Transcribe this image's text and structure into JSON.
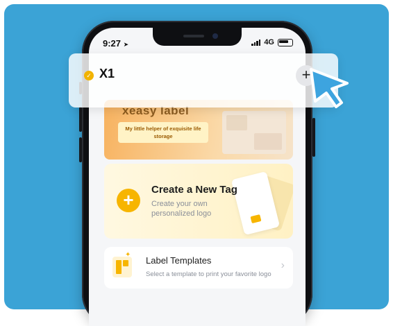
{
  "status_bar": {
    "time": "9:27",
    "network": "4G"
  },
  "header": {
    "device_name": "X1"
  },
  "banner": {
    "title": "xeasy label",
    "subtitle": "My little helper of exquisite life storage"
  },
  "create_card": {
    "title": "Create a New Tag",
    "subtitle": "Create your own personalized logo"
  },
  "templates_card": {
    "title": "Label Templates",
    "subtitle": "Select a template to print your favorite logo"
  },
  "colors": {
    "background": "#3ba3d6",
    "accent": "#f7b500",
    "cursor": "#3da4df"
  },
  "icons": [
    "check-icon",
    "plus-icon",
    "cursor-icon",
    "chevron-right-icon",
    "signal-icon",
    "battery-icon",
    "template-icon"
  ]
}
